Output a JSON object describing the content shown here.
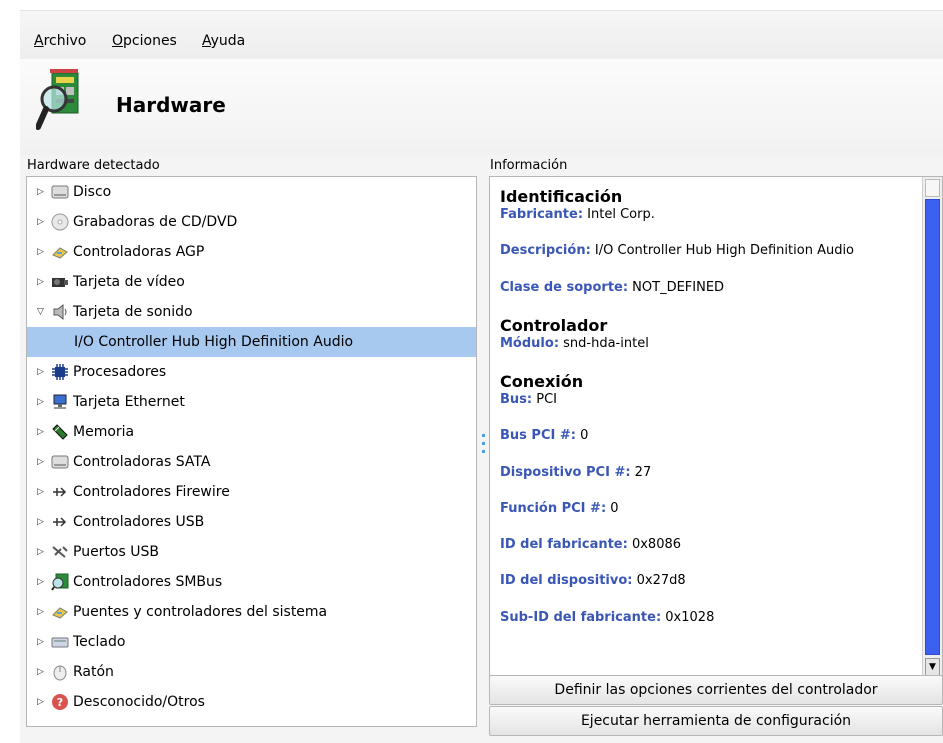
{
  "menubar": {
    "items": [
      {
        "accel": "A",
        "rest": "rchivo"
      },
      {
        "accel": "O",
        "rest": "pciones"
      },
      {
        "accel": "A",
        "rest": "yuda"
      }
    ]
  },
  "banner": {
    "title": "Hardware",
    "icon": "hardware-magnifier-icon"
  },
  "tree": {
    "group_label": "Hardware detectado",
    "items": [
      {
        "label": "Disco",
        "icon": "disk-icon",
        "expanded": false
      },
      {
        "label": "Grabadoras de CD/DVD",
        "icon": "cd-icon",
        "expanded": false
      },
      {
        "label": "Controladoras AGP",
        "icon": "agp-icon",
        "expanded": false
      },
      {
        "label": "Tarjeta de vídeo",
        "icon": "video-card-icon",
        "expanded": false
      },
      {
        "label": "Tarjeta de sonido",
        "icon": "speaker-icon",
        "expanded": true
      },
      {
        "label": "I/O Controller Hub High Definition Audio",
        "icon": "",
        "selected": true
      },
      {
        "label": "Procesadores",
        "icon": "processor-icon",
        "expanded": false
      },
      {
        "label": "Tarjeta Ethernet",
        "icon": "ethernet-icon",
        "expanded": false
      },
      {
        "label": "Memoria",
        "icon": "memory-icon",
        "expanded": false
      },
      {
        "label": "Controladoras SATA",
        "icon": "sata-icon",
        "expanded": false
      },
      {
        "label": "Controladores Firewire",
        "icon": "firewire-icon",
        "expanded": false
      },
      {
        "label": "Controladores USB",
        "icon": "usb-icon",
        "expanded": false
      },
      {
        "label": "Puertos USB",
        "icon": "usb-port-icon",
        "expanded": false
      },
      {
        "label": "Controladores SMBus",
        "icon": "smbus-icon",
        "expanded": false
      },
      {
        "label": "Puentes y controladores del sistema",
        "icon": "bridge-icon",
        "expanded": false
      },
      {
        "label": "Teclado",
        "icon": "keyboard-icon",
        "expanded": false
      },
      {
        "label": "Ratón",
        "icon": "mouse-icon",
        "expanded": false
      },
      {
        "label": "Desconocido/Otros",
        "icon": "unknown-icon",
        "expanded": false
      }
    ]
  },
  "info": {
    "group_label": "Información",
    "sections": [
      {
        "heading": "Identificación",
        "fields": [
          {
            "key": "Fabricante:",
            "value": " Intel Corp."
          },
          {
            "key": "Descripción:",
            "value": " I/O Controller Hub High Definition Audio"
          },
          {
            "key": "Clase de soporte:",
            "value": " NOT_DEFINED"
          }
        ]
      },
      {
        "heading": "Controlador",
        "fields": [
          {
            "key": "Módulo:",
            "value": " snd-hda-intel"
          }
        ]
      },
      {
        "heading": "Conexión",
        "fields": [
          {
            "key": "Bus:",
            "value": " PCI"
          },
          {
            "key": "Bus PCI #:",
            "value": " 0"
          },
          {
            "key": "Dispositivo PCI #:",
            "value": " 27"
          },
          {
            "key": "Función PCI #:",
            "value": " 0"
          },
          {
            "key": "ID del fabricante:",
            "value": " 0x8086"
          },
          {
            "key": "ID del dispositivo:",
            "value": " 0x27d8"
          },
          {
            "key": "Sub-ID del fabricante:",
            "value": " 0x1028"
          }
        ]
      }
    ]
  },
  "buttons": {
    "driver_options": "Definir las opciones corrientes del controlador",
    "run_config": "Ejecutar herramienta de configuración"
  },
  "colors": {
    "selection": "#a7c8ef",
    "field_key": "#3a57b5",
    "scroll_thumb": "#3c61f0"
  }
}
